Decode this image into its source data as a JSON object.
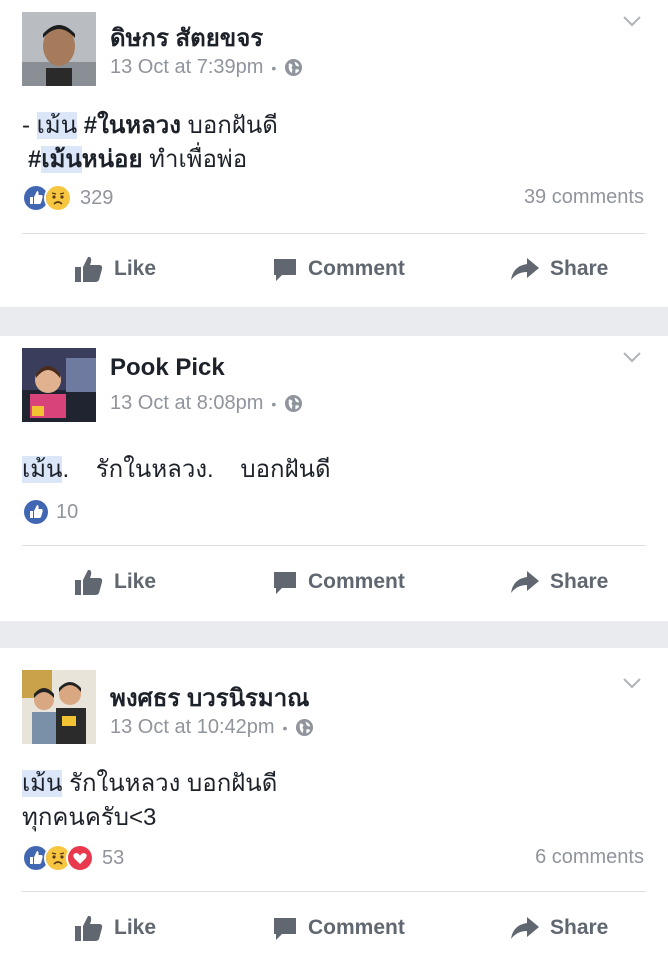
{
  "posts": [
    {
      "author": "ดิษกร สัตยขจร",
      "time": "13 Oct at 7:39pm",
      "lines": [
        {
          "prefix": "- ",
          "hl": "เม้น",
          "tag": " #ในหลวง",
          "rest": " บอกฝันดี"
        },
        {
          "prefix": "",
          "hl": "",
          "tag": "#เม้นหน่อย",
          "rest": " ทำเพื่อพ่อ"
        }
      ],
      "reaction_count": "329",
      "comments": "39 comments"
    },
    {
      "author": "Pook Pick",
      "time": "13 Oct at 8:08pm",
      "lines": [
        {
          "prefix": "",
          "hl": "เม้น",
          "tag": "",
          "rest": ".    รักในหลวง.    บอกฝันดี"
        }
      ],
      "reaction_count": "10",
      "comments": ""
    },
    {
      "author": "พงศธร บวรนิรมาณ",
      "time": "13 Oct at 10:42pm",
      "lines": [
        {
          "prefix": "",
          "hl": "เม้น",
          "tag": "",
          "rest": " รักในหลวง บอกฝันดี"
        },
        {
          "prefix": "",
          "hl": "",
          "tag": "",
          "rest": "ทุกคนครับ<3"
        }
      ],
      "reaction_count": "53",
      "comments": "6 comments"
    }
  ],
  "actions": {
    "like": "Like",
    "comment": "Comment",
    "share": "Share"
  },
  "meta": {
    "separator": "•"
  },
  "colors": {
    "like_blue": "#4267b2",
    "love_red": "#e9394f",
    "sad_yellow": "#f7c640",
    "secondary_text": "#90949c",
    "feed_bg": "#e9ebee"
  }
}
